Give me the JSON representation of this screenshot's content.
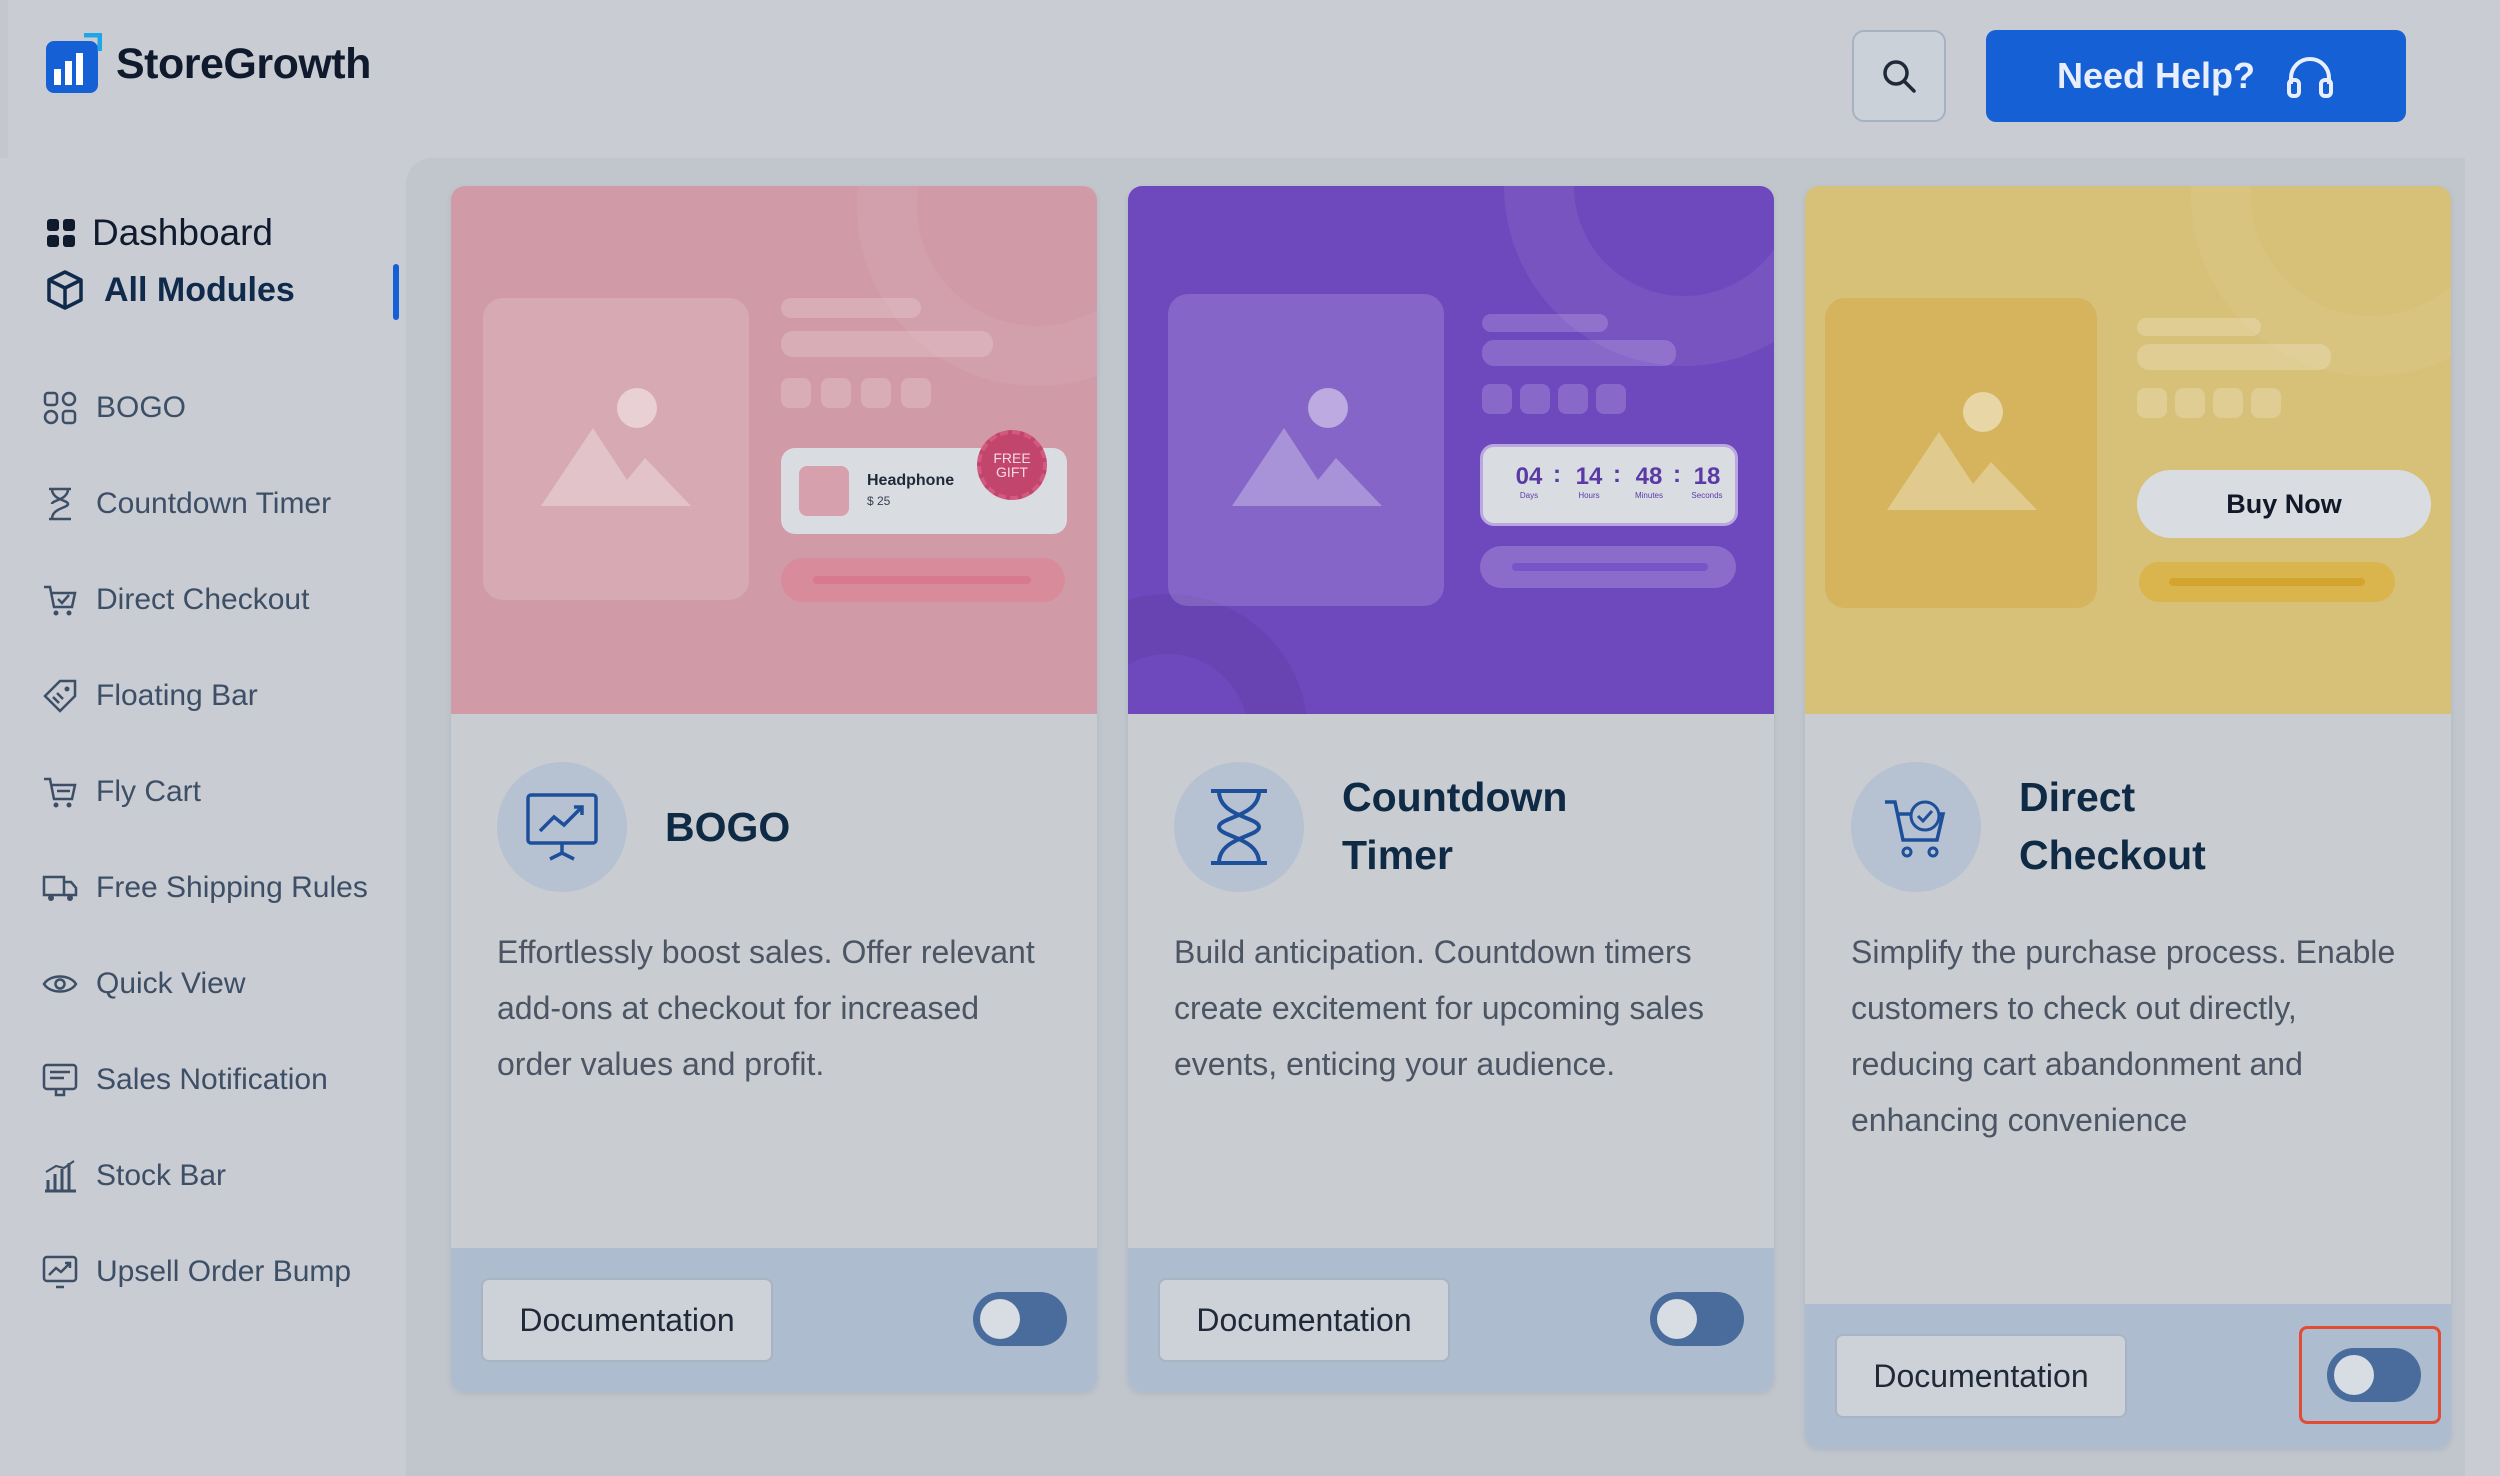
{
  "brand": {
    "name": "StoreGrowth",
    "accent": "#1560d4"
  },
  "header": {
    "search_icon": "search-icon",
    "help_label": "Need Help?",
    "help_icon": "headphones-icon"
  },
  "sidebar": {
    "dashboard_label": "Dashboard",
    "all_modules_label": "All Modules",
    "items": [
      {
        "label": "BOGO",
        "icon": "bogo-icon"
      },
      {
        "label": "Countdown Timer",
        "icon": "hourglass-icon"
      },
      {
        "label": "Direct Checkout",
        "icon": "cart-check-icon"
      },
      {
        "label": "Floating Bar",
        "icon": "tag-icon"
      },
      {
        "label": "Fly Cart",
        "icon": "cart-icon"
      },
      {
        "label": "Free Shipping Rules",
        "icon": "truck-icon"
      },
      {
        "label": "Quick View",
        "icon": "eye-icon"
      },
      {
        "label": "Sales Notification",
        "icon": "notification-icon"
      },
      {
        "label": "Stock Bar",
        "icon": "bar-chart-icon"
      },
      {
        "label": "Upsell Order Bump",
        "icon": "trend-icon"
      }
    ]
  },
  "cards": [
    {
      "title": "BOGO",
      "description": "Effortlessly boost sales. Offer relevant add-ons at checkout for increased order values and profit.",
      "doc_label": "Documentation",
      "toggle_on": false,
      "hero": {
        "product_name": "Headphone",
        "product_price": "$ 25",
        "badge": "FREE GIFT"
      }
    },
    {
      "title": "Countdown Timer",
      "description": "Build anticipation. Countdown timers create excitement for upcoming sales events, enticing your audience.",
      "doc_label": "Documentation",
      "toggle_on": false,
      "hero": {
        "timer": [
          {
            "value": "04",
            "unit": "Days"
          },
          {
            "value": "14",
            "unit": "Hours"
          },
          {
            "value": "48",
            "unit": "Minutes"
          },
          {
            "value": "18",
            "unit": "Seconds"
          }
        ],
        "separator": ":"
      }
    },
    {
      "title": "Direct Checkout",
      "description": "Simplify the purchase process. Enable customers to check out directly, reducing cart abandonment and enhancing convenience",
      "doc_label": "Documentation",
      "toggle_on": false,
      "hero": {
        "buy_label": "Buy Now"
      }
    }
  ]
}
